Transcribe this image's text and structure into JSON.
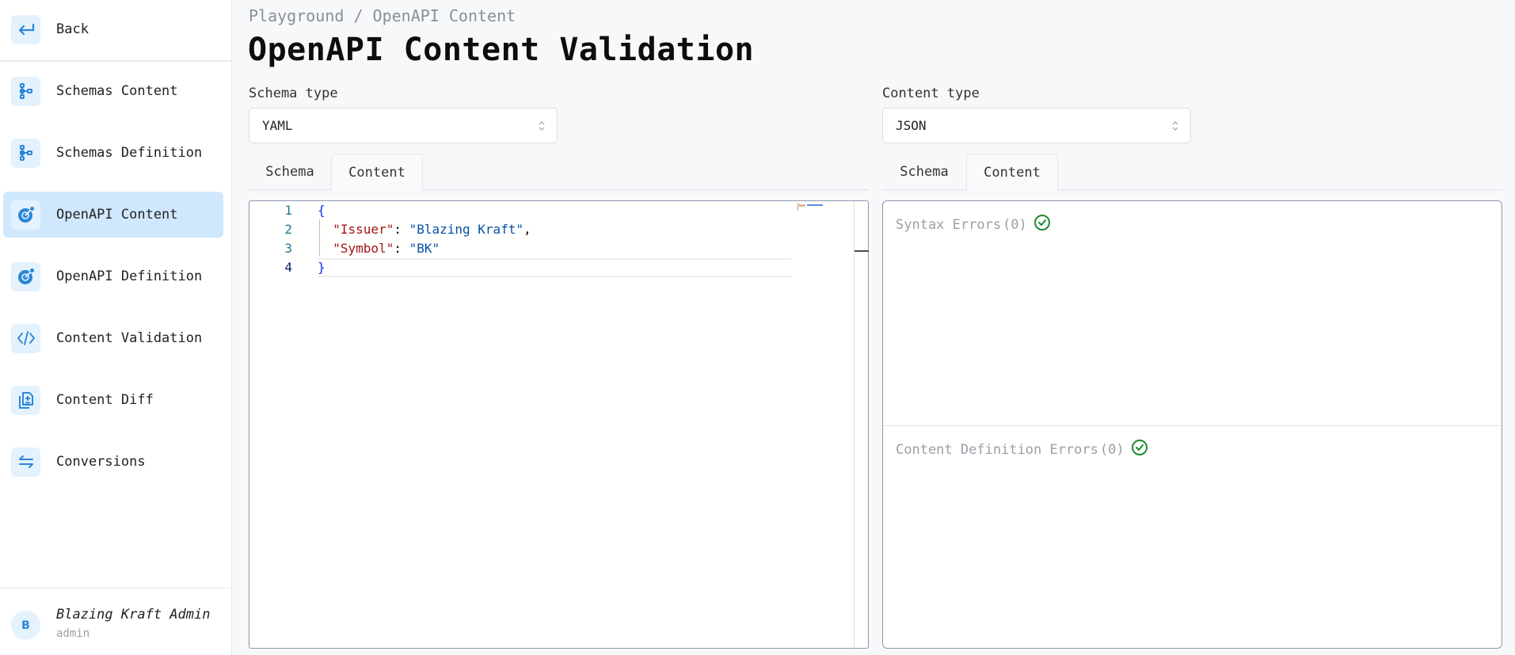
{
  "sidebar": {
    "back": {
      "label": "Back",
      "icon": "arrow-return-left-icon"
    },
    "items": [
      {
        "label": "Schemas Content",
        "icon": "schema-tree-icon",
        "active": false
      },
      {
        "label": "Schemas Definition",
        "icon": "schema-tree-icon",
        "active": false
      },
      {
        "label": "OpenAPI Content",
        "icon": "openapi-icon",
        "active": true
      },
      {
        "label": "OpenAPI Definition",
        "icon": "openapi-icon",
        "active": false
      },
      {
        "label": "Content Validation",
        "icon": "code-icon",
        "active": false
      },
      {
        "label": "Content Diff",
        "icon": "file-diff-icon",
        "active": false
      },
      {
        "label": "Conversions",
        "icon": "arrows-exchange-icon",
        "active": false
      }
    ],
    "user": {
      "initial": "B",
      "name": "Blazing Kraft Admin",
      "role": "admin"
    }
  },
  "header": {
    "breadcrumb": "Playground / OpenAPI Content",
    "title": "OpenAPI Content Validation"
  },
  "left_panel": {
    "select_label": "Schema type",
    "select_value": "YAML",
    "tabs": [
      {
        "label": "Schema",
        "active": false
      },
      {
        "label": "Content",
        "active": true
      }
    ],
    "editor": {
      "lines": [
        {
          "n": "1",
          "tokens": [
            {
              "t": "b",
              "v": "{"
            }
          ]
        },
        {
          "n": "2",
          "tokens": [
            {
              "t": "k",
              "v": "  \"Issuer\""
            },
            {
              "t": "p",
              "v": ": "
            },
            {
              "t": "s",
              "v": "\"Blazing Kraft\""
            },
            {
              "t": "p",
              "v": ","
            }
          ]
        },
        {
          "n": "3",
          "tokens": [
            {
              "t": "k",
              "v": "  \"Symbol\""
            },
            {
              "t": "p",
              "v": ": "
            },
            {
              "t": "s",
              "v": "\"BK\""
            }
          ]
        },
        {
          "n": "4",
          "tokens": [
            {
              "t": "b",
              "v": "}"
            }
          ]
        }
      ],
      "current_line": 4
    }
  },
  "right_panel": {
    "select_label": "Content type",
    "select_value": "JSON",
    "tabs": [
      {
        "label": "Schema",
        "active": false
      },
      {
        "label": "Content",
        "active": true
      }
    ],
    "syntax_errors": {
      "label": "Syntax Errors",
      "count": "(0)",
      "status_color": "#1e8a2e"
    },
    "definition_errors": {
      "label": "Content Definition Errors",
      "count": "(0)",
      "status_color": "#1e8a2e"
    }
  }
}
